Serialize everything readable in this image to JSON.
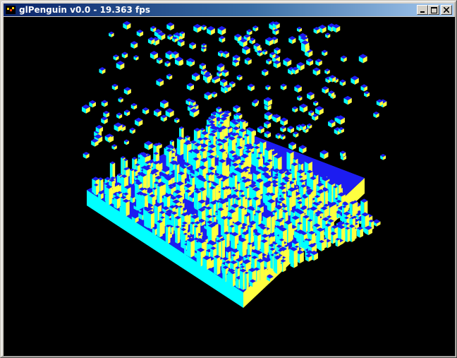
{
  "window": {
    "title": "glPenguin v0.0 - 19.363 fps",
    "icon": "app-icon",
    "buttons": [
      {
        "name": "minimize-button",
        "icon": "minimize-icon"
      },
      {
        "name": "maximize-button",
        "icon": "maximize-icon"
      },
      {
        "name": "close-button",
        "icon": "close-icon"
      }
    ]
  },
  "scene": {
    "background": "#000000",
    "colors": {
      "top": "#1c1cf0",
      "left": "#00ffff",
      "right": "#ffff40"
    }
  }
}
